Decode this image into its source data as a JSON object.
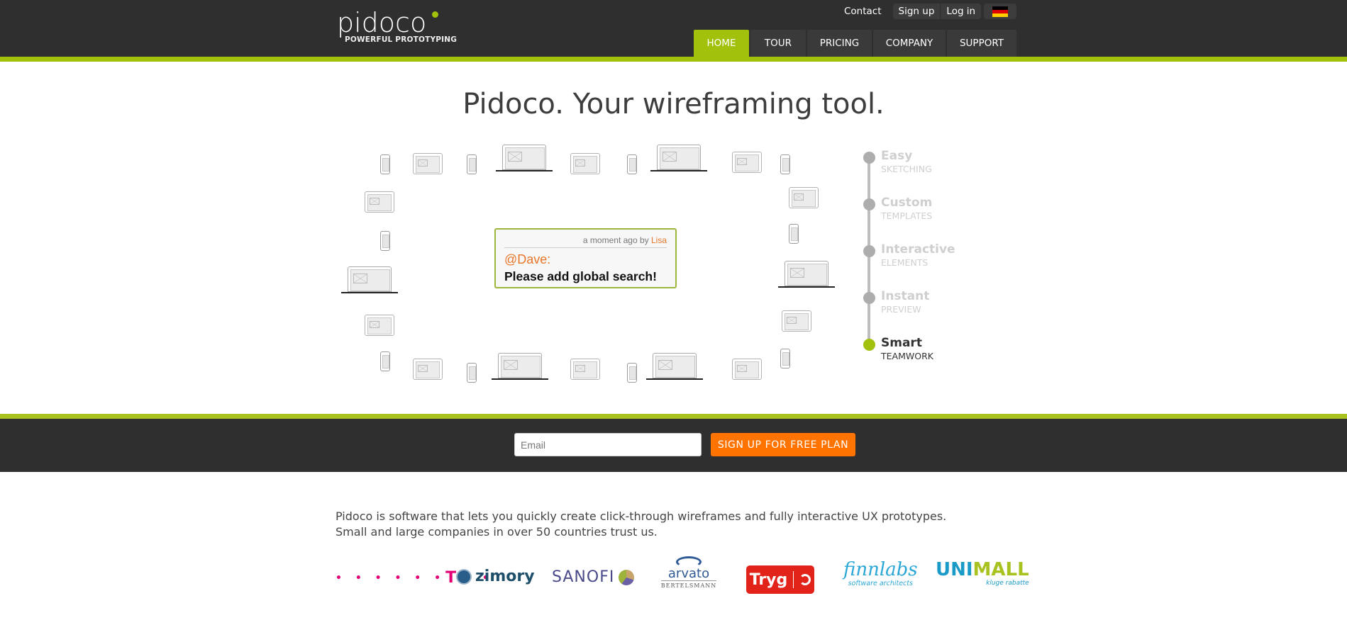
{
  "header": {
    "logo": {
      "word": "pidoco",
      "tagline": "POWERFUL PROTOTYPING"
    },
    "top_links": {
      "contact": "Contact",
      "sign_up": "Sign up",
      "log_in": "Log in",
      "language_flag": "flag-germany-icon"
    },
    "nav": [
      {
        "label": "HOME",
        "active": true
      },
      {
        "label": "TOUR",
        "active": false
      },
      {
        "label": "PRICING",
        "active": false
      },
      {
        "label": "COMPANY",
        "active": false
      },
      {
        "label": "SUPPORT",
        "active": false
      }
    ],
    "colors": {
      "brand_green": "#a2c10c",
      "header_bg": "#2f2f2f"
    }
  },
  "hero": {
    "title": "Pidoco. Your wireframing tool.",
    "comment": {
      "meta_prefix": "a moment ago by ",
      "author": "Lisa",
      "mention": "@Dave:",
      "message": "Please add global search!"
    },
    "devices": [
      "phone",
      "tablet",
      "laptop"
    ],
    "steps": [
      {
        "title": "Easy",
        "subtitle": "SKETCHING",
        "active": false
      },
      {
        "title": "Custom",
        "subtitle": "TEMPLATES",
        "active": false
      },
      {
        "title": "Interactive",
        "subtitle": "ELEMENTS",
        "active": false
      },
      {
        "title": "Instant",
        "subtitle": "PREVIEW",
        "active": false
      },
      {
        "title": "Smart",
        "subtitle": "TEAMWORK",
        "active": true
      }
    ]
  },
  "signup": {
    "email_placeholder": "Email",
    "email_value": "",
    "button_label": "SIGN UP FOR FREE PLAN",
    "button_color": "#ff7300"
  },
  "intro": {
    "line1": "Pidoco is software that lets you quickly create click-through wireframes and fully interactive UX prototypes.",
    "line2": "Small and large companies in over 50 countries trust us."
  },
  "customers": {
    "telekom": {
      "mark": "T",
      "dots_left": "• • • • • •",
      "dots_right": "• •"
    },
    "zimory": {
      "name": "zimory"
    },
    "sanofi": {
      "name": "SANOFI"
    },
    "arvato": {
      "name": "arvato",
      "sub": "BERTELSMANN"
    },
    "tryg": {
      "name": "Tryg"
    },
    "finnlabs": {
      "name": "finnlabs",
      "sub": "software architects"
    },
    "unimall": {
      "name_a": "UNI",
      "name_b": "MALL",
      "sub": "kluge rabatte"
    }
  }
}
